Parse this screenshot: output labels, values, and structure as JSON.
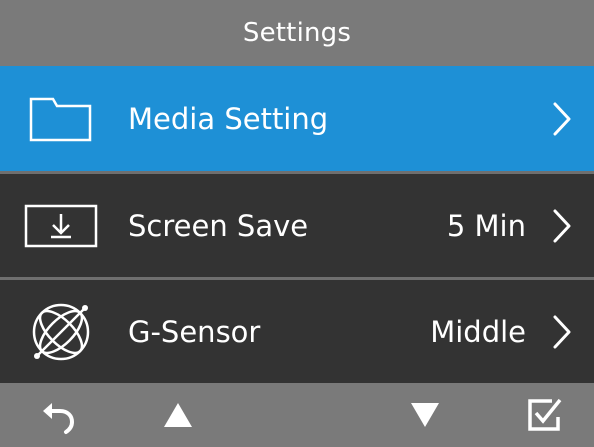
{
  "header": {
    "title": "Settings"
  },
  "menu": {
    "items": [
      {
        "label": "Media Setting",
        "value": "",
        "icon": "folder-icon",
        "selected": true
      },
      {
        "label": "Screen Save",
        "value": "5 Min",
        "icon": "screen-download-icon",
        "selected": false
      },
      {
        "label": "G-Sensor",
        "value": "Middle",
        "icon": "g-sensor-icon",
        "selected": false
      }
    ]
  },
  "footer": {
    "buttons": [
      {
        "icon": "back-arrow-icon"
      },
      {
        "icon": "up-triangle-icon"
      },
      {
        "icon": "down-triangle-icon"
      },
      {
        "icon": "confirm-checkbox-icon"
      }
    ]
  },
  "colors": {
    "selected_bg": "#1e90d6",
    "row_bg": "#333333",
    "bar_bg": "#7a7a7a",
    "text": "#ffffff"
  }
}
